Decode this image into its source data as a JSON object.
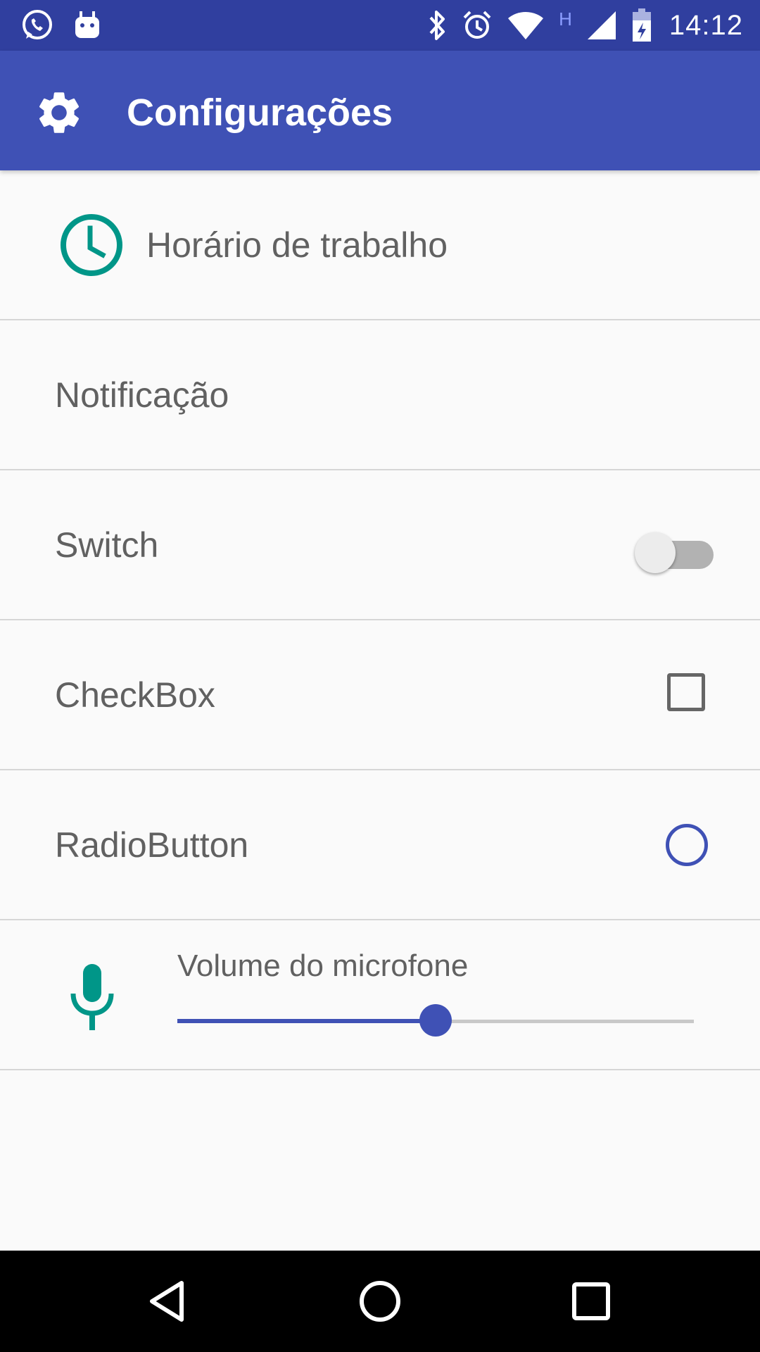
{
  "status_bar": {
    "time": "14:12",
    "network_type": "H",
    "left_icons": [
      "whatsapp-icon",
      "android-debug-icon"
    ],
    "right_icons": [
      "bluetooth-icon",
      "alarm-icon",
      "wifi-icon",
      "network-type-icon",
      "signal-icon",
      "battery-charging-icon"
    ],
    "color": "#303f9f"
  },
  "app_bar": {
    "title": "Configurações",
    "icon": "gear-icon",
    "color": "#3f51b5"
  },
  "settings": {
    "work_hours": {
      "label": "Horário de trabalho",
      "icon": "clock-icon",
      "icon_color": "#009688"
    },
    "notification": {
      "label": "Notificação"
    },
    "switch": {
      "label": "Switch",
      "checked": false
    },
    "checkbox": {
      "label": "CheckBox",
      "checked": false
    },
    "radio": {
      "label": "RadioButton",
      "checked": false,
      "color": "#3f51b5"
    },
    "volume": {
      "label": "Volume do microfone",
      "icon": "microphone-icon",
      "icon_color": "#009688",
      "value": 0.5
    }
  },
  "nav_bar": {
    "buttons": [
      "back-icon",
      "home-icon",
      "recents-icon"
    ]
  }
}
